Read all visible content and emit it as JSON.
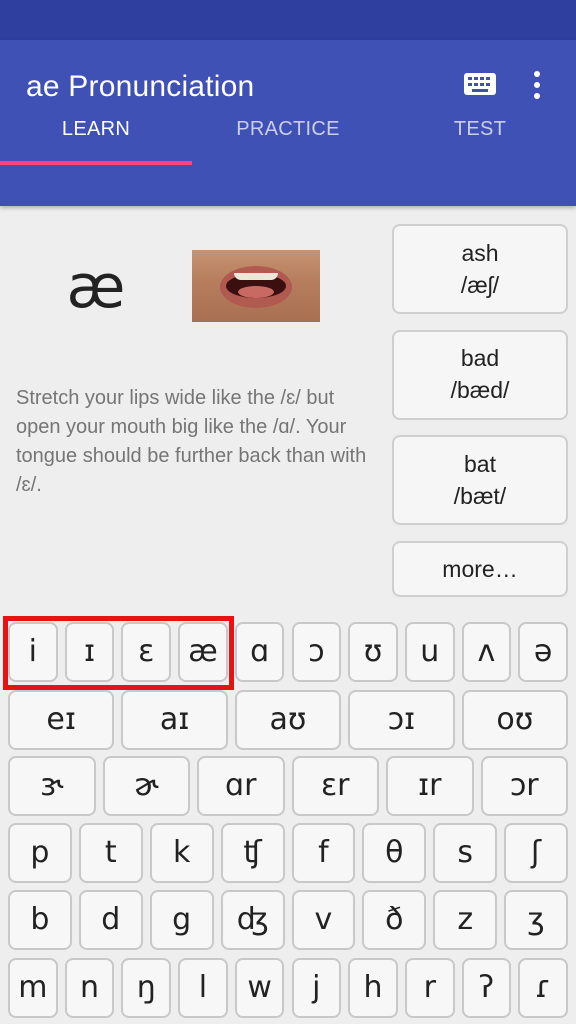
{
  "app": {
    "title": "ae Pronunciation"
  },
  "toolbar": {
    "keyboard_icon": "keyboard-icon",
    "more_icon": "more-vert-icon"
  },
  "tabs": [
    {
      "label": "LEARN",
      "active": true
    },
    {
      "label": "PRACTICE",
      "active": false
    },
    {
      "label": "TEST",
      "active": false
    }
  ],
  "colors": {
    "primary": "#3f51b5",
    "primary_dark": "#2f3f9f",
    "accent": "#ff4081",
    "highlight": "#e91212"
  },
  "learn": {
    "symbol": "æ",
    "description": "Stretch your lips wide like the /ɛ/ but open your mouth big like the /ɑ/. Your tongue should be further back than with /ɛ/.",
    "examples": [
      {
        "word": "ash",
        "ipa": "/æʃ/"
      },
      {
        "word": "bad",
        "ipa": "/bæd/"
      },
      {
        "word": "bat",
        "ipa": "/bæt/"
      }
    ],
    "more_label": "more…"
  },
  "keyboard": {
    "rows": [
      [
        "i",
        "ɪ",
        "ɛ",
        "æ",
        "ɑ",
        "ɔ",
        "ʊ",
        "u",
        "ʌ",
        "ə"
      ],
      [
        "eɪ",
        "aɪ",
        "aʊ",
        "ɔɪ",
        "oʊ"
      ],
      [
        "ɝ",
        "ɚ",
        "ɑr",
        "ɛr",
        "ɪr",
        "ɔr"
      ],
      [
        "p",
        "t",
        "k",
        "ʧ",
        "f",
        "θ",
        "s",
        "ʃ"
      ],
      [
        "b",
        "d",
        "g",
        "ʤ",
        "v",
        "ð",
        "z",
        "ʒ"
      ],
      [
        "m",
        "n",
        "ŋ",
        "l",
        "w",
        "j",
        "h",
        "r",
        "ʔ",
        "ɾ"
      ]
    ]
  }
}
